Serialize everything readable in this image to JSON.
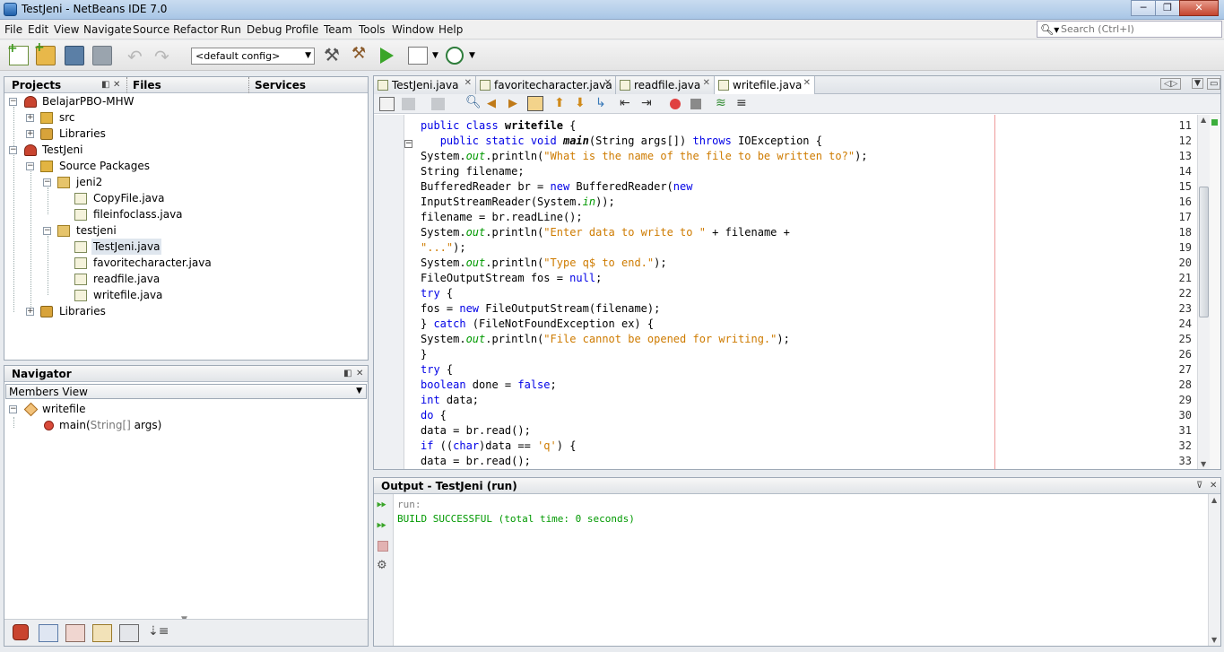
{
  "window": {
    "title": "TestJeni - NetBeans IDE 7.0",
    "minimize": "─",
    "maximize": "❐",
    "close": "✕"
  },
  "menu": [
    "File",
    "Edit",
    "View",
    "Navigate",
    "Source",
    "Refactor",
    "Run",
    "Debug",
    "Profile",
    "Team",
    "Tools",
    "Window",
    "Help"
  ],
  "search": {
    "placeholder": "Search (Ctrl+I)"
  },
  "toolbar": {
    "config": "<default config>"
  },
  "projects_panel": {
    "tabs": [
      "Projects",
      "Files",
      "Services"
    ],
    "tree": [
      {
        "label": "BelajarPBO-MHW",
        "icon": "project-icon"
      },
      {
        "label": "src",
        "icon": "folder-icon"
      },
      {
        "label": "Libraries",
        "icon": "library-icon"
      },
      {
        "label": "TestJeni",
        "icon": "project-icon"
      },
      {
        "label": "Source Packages",
        "icon": "folder-icon"
      },
      {
        "label": "jeni2",
        "icon": "package-icon"
      },
      {
        "label": "CopyFile.java",
        "icon": "java-file-icon"
      },
      {
        "label": "fileinfoclass.java",
        "icon": "java-file-icon"
      },
      {
        "label": "testjeni",
        "icon": "package-icon"
      },
      {
        "label": "TestJeni.java",
        "icon": "java-file-icon"
      },
      {
        "label": "favoritecharacter.java",
        "icon": "java-file-icon"
      },
      {
        "label": "readfile.java",
        "icon": "java-file-icon"
      },
      {
        "label": "writefile.java",
        "icon": "java-file-icon"
      },
      {
        "label": "Libraries",
        "icon": "library-icon"
      }
    ]
  },
  "navigator": {
    "title": "Navigator",
    "view": "Members View",
    "class_name": "writefile",
    "method_name": "main(",
    "method_params": "String[]",
    "method_args": " args)"
  },
  "editor": {
    "tabs": [
      "TestJeni.java",
      "favoritecharacter.java",
      "readfile.java",
      "writefile.java"
    ],
    "active_tab": 3,
    "lines": [
      {
        "n": "11",
        "text": "public class writefile {"
      },
      {
        "n": "12",
        "text": "    public static void main(String args[]) throws IOException {"
      },
      {
        "n": "13",
        "text": "System.out.println(\"What is the name of the file to be written to?\");"
      },
      {
        "n": "14",
        "text": "String filename;"
      },
      {
        "n": "15",
        "text": "BufferedReader br = new BufferedReader(new"
      },
      {
        "n": "16",
        "text": "InputStreamReader(System.in));"
      },
      {
        "n": "17",
        "text": "filename = br.readLine();"
      },
      {
        "n": "18",
        "text": "System.out.println(\"Enter data to write to \" + filename +"
      },
      {
        "n": "19",
        "text": "\"...\");"
      },
      {
        "n": "20",
        "text": "System.out.println(\"Type q$ to end.\");"
      },
      {
        "n": "21",
        "text": "FileOutputStream fos = null;"
      },
      {
        "n": "22",
        "text": "try {"
      },
      {
        "n": "23",
        "text": "fos = new FileOutputStream(filename);"
      },
      {
        "n": "24",
        "text": "} catch (FileNotFoundException ex) {"
      },
      {
        "n": "25",
        "text": "System.out.println(\"File cannot be opened for writing.\");"
      },
      {
        "n": "26",
        "text": "}"
      },
      {
        "n": "27",
        "text": "try {"
      },
      {
        "n": "28",
        "text": "boolean done = false;"
      },
      {
        "n": "29",
        "text": "int data;"
      },
      {
        "n": "30",
        "text": "do {"
      },
      {
        "n": "31",
        "text": "data = br.read();"
      },
      {
        "n": "32",
        "text": "if ((char)data == 'q') {"
      },
      {
        "n": "33",
        "text": "data = br.read();"
      }
    ]
  },
  "output": {
    "title": "Output - TestJeni (run)",
    "line1": "run:",
    "line2": "BUILD SUCCESSFUL (total time: 0 seconds)"
  }
}
